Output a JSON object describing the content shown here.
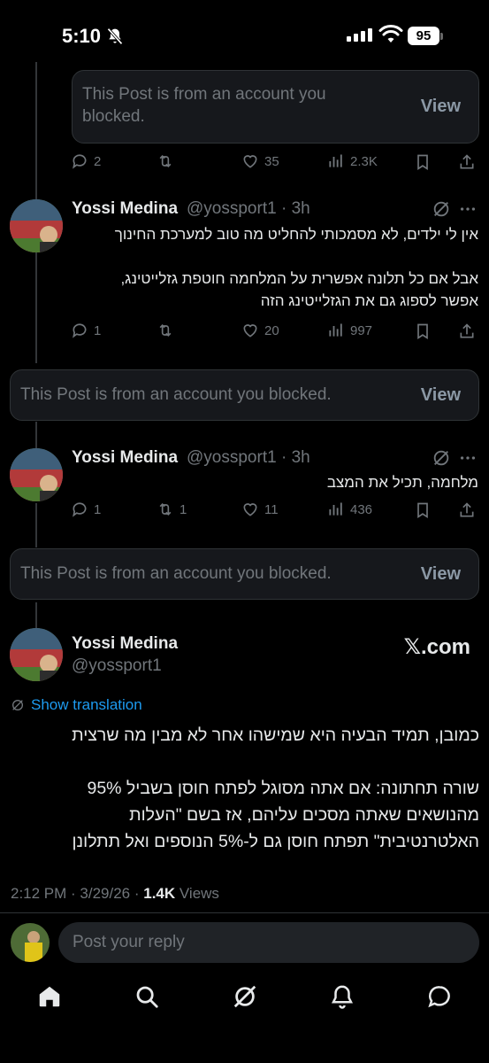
{
  "status_bar": {
    "time": "5:10",
    "battery": "95"
  },
  "blocked_posts": [
    {
      "text": "This Post is from an account you blocked.",
      "view_label": "View"
    },
    {
      "text": "This Post is from an account you blocked.",
      "view_label": "View"
    },
    {
      "text": "This Post is from an account you blocked.",
      "view_label": "View"
    }
  ],
  "action_rows": [
    {
      "replies": "2",
      "reposts": "",
      "likes": "35",
      "views": "2.3K"
    },
    {
      "replies": "1",
      "reposts": "",
      "likes": "20",
      "views": "997"
    },
    {
      "replies": "1",
      "reposts": "1",
      "likes": "11",
      "views": "436"
    }
  ],
  "replies": [
    {
      "name": "Yossi Medina",
      "handle": "@yossport1",
      "time": "· 3h",
      "text": "אין לי ילדים, לא מסמכותי להחליט מה טוב למערכת החינוך\n\nאבל אם כל תלונה אפשרית על המלחמה חוטפת גזלייטינג,\nאפשר לספוג גם את הגזלייטינג הזה"
    },
    {
      "name": "Yossi Medina",
      "handle": "@yossport1",
      "time": "· 3h",
      "text": "מלחמה, תכיל את המצב"
    }
  ],
  "main_post": {
    "name": "Yossi Medina",
    "handle": "@yossport1",
    "badge": "𝕏.com",
    "show_translation": "Show translation",
    "text": "כמובן, תמיד הבעיה היא שמישהו אחר לא מבין מה שרצית\n\nשורה תחתונה: אם אתה מסוגל לפתח חוסן בשביל 95%\nמהנושאים שאתה מסכים עליהם, אז בשם \"העלות\nהאלטרנטיבית\" תפתח חוסן גם ל-5% הנוספים ואל תתלונן",
    "timestamp": "2:12 PM · 3/29/26 · ",
    "views_count": "1.4K",
    "views_label": " Views"
  },
  "reply_box": {
    "placeholder": "Post your reply"
  },
  "colors": {
    "background": "#000000",
    "text": "#e7e9ea",
    "muted": "#71767b",
    "link": "#1d9bf0",
    "card": "#16181c"
  },
  "icons": [
    "bell-off-icon",
    "signal-icon",
    "wifi-icon",
    "reply-icon",
    "repost-icon",
    "like-icon",
    "views-icon",
    "bookmark-icon",
    "share-icon",
    "grok-icon",
    "more-icon",
    "globe-icon",
    "home-icon",
    "search-icon",
    "notifications-icon",
    "messages-icon"
  ]
}
